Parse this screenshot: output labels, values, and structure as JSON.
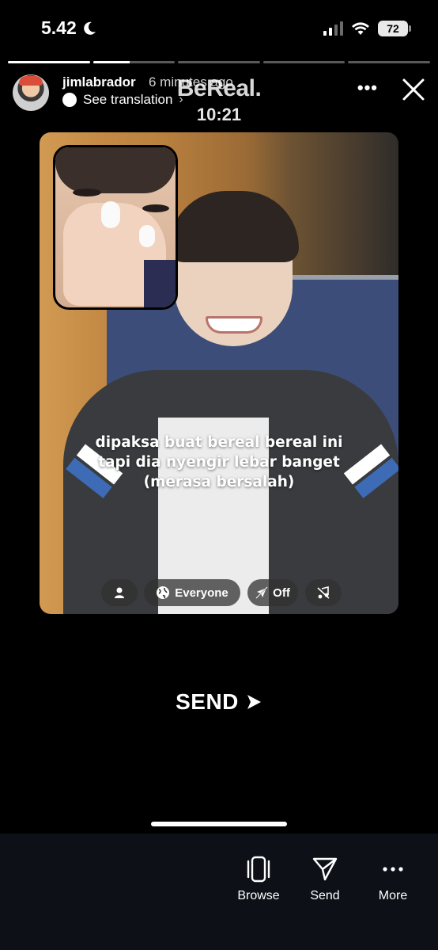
{
  "status_bar": {
    "time": "5.42",
    "battery": "72"
  },
  "story": {
    "progress": [
      1,
      0.45,
      0,
      0,
      0
    ],
    "username": "jimlabrador",
    "posted_time": "6 minutes ago",
    "translation_label": "See translation",
    "bereal_title": "BeReal.",
    "bereal_time": "10:21",
    "caption": "dipaksa buat bereal bereal ini tapi dia nyengir lebar banget (merasa bersalah)",
    "chips": {
      "audience": "Everyone",
      "location": "Off"
    },
    "send_label": "SEND"
  },
  "bottom_bar": {
    "browse_label": "Browse",
    "send_label": "Send",
    "more_label": "More"
  }
}
